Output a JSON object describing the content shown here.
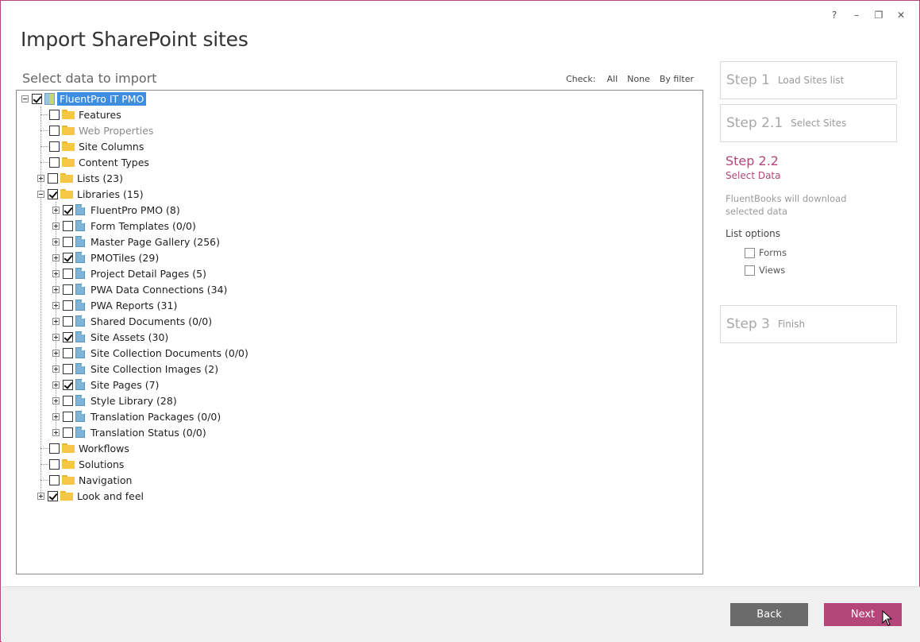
{
  "window": {
    "title": "Import SharePoint sites",
    "controls": [
      "?",
      "–",
      "❐",
      "✕"
    ]
  },
  "section": {
    "label": "Select data to import",
    "check_label": "Check:",
    "check_options": [
      "All",
      "None",
      "By filter"
    ]
  },
  "tree": {
    "root": "FluentPro IT PMO",
    "items": [
      "Features",
      "Web Properties",
      "Site Columns",
      "Content Types",
      "Lists (23)",
      "Libraries (15)",
      "FluentPro PMO (8)",
      "Form Templates (0/0)",
      "Master Page Gallery (256)",
      "PMOTiles (29)",
      "Project Detail Pages (5)",
      "PWA Data Connections (34)",
      "PWA Reports (31)",
      "Shared Documents (0/0)",
      "Site Assets (30)",
      "Site Collection Documents (0/0)",
      "Site Collection Images (2)",
      "Site Pages (7)",
      "Style Library (28)",
      "Translation Packages (0/0)",
      "Translation Status (0/0)",
      "Workflows",
      "Solutions",
      "Navigation",
      "Look and feel"
    ]
  },
  "steps": {
    "step1": {
      "num": "Step 1",
      "name": "Load Sites list"
    },
    "step21": {
      "num": "Step 2.1",
      "name": "Select Sites"
    },
    "step22": {
      "num": "Step 2.2",
      "name": "Select Data",
      "desc": "FluentBooks will download selected data",
      "options_title": "List options",
      "options": [
        "Forms",
        "Views"
      ]
    },
    "step3": {
      "num": "Step 3",
      "name": "Finish"
    }
  },
  "footer": {
    "back": "Back",
    "next": "Next"
  },
  "colors": {
    "accent": "#b5467a",
    "selection": "#3d8ee0",
    "back_button": "#6b6b6b"
  }
}
